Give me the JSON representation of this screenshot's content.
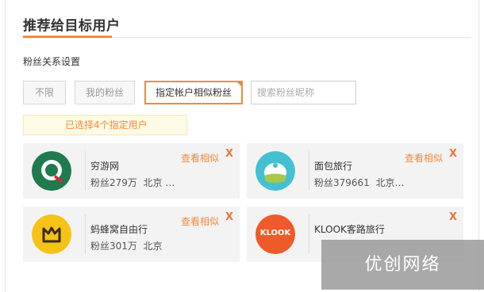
{
  "header": {
    "title": "推荐给目标用户"
  },
  "section": {
    "label": "粉丝关系设置"
  },
  "options": [
    {
      "label": "不限"
    },
    {
      "label": "我的粉丝"
    },
    {
      "label": "指定帐户相似粉丝"
    }
  ],
  "search": {
    "placeholder": "搜索粉丝昵称",
    "value": ""
  },
  "notice": {
    "text": "已选择4个指定用户"
  },
  "cards": [
    {
      "name": "穷游网",
      "fans": "粉丝279万",
      "city": "北京 …",
      "action": "查看相似",
      "close": "X",
      "icon": "qyer-logo-icon"
    },
    {
      "name": "面包旅行",
      "fans": "粉丝379661",
      "city": "北京…",
      "action": "查看相似",
      "close": "X",
      "icon": "bread-trip-logo-icon"
    },
    {
      "name": "蚂蜂窝自由行",
      "fans": "粉丝301万",
      "city": "北京",
      "action": "查看相似",
      "close": "X",
      "icon": "mafengwo-logo-icon"
    },
    {
      "name": "KLOOK客路旅行",
      "fans": "",
      "city": "",
      "action": "",
      "close": "X",
      "icon": "klook-logo-icon",
      "logo_text": "KLOOK"
    }
  ],
  "watermark": {
    "text": "优创网络"
  },
  "colors": {
    "accent": "#f08a3c",
    "card_bg": "#f3f3f3",
    "notice_bg": "#fdfae6"
  }
}
